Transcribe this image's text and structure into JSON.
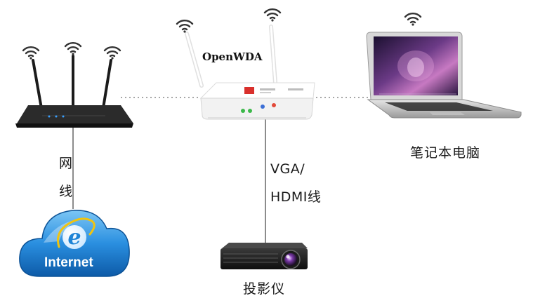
{
  "diagram": {
    "nodes": {
      "router": {
        "label": ""
      },
      "openwda": {
        "label": "OpenWDA"
      },
      "laptop": {
        "label": "笔记本电脑"
      },
      "internet": {
        "label": "Internet"
      },
      "projector": {
        "label": "投影仪"
      }
    },
    "edges": {
      "router_internet": {
        "label_line1": "网",
        "label_line2": "线"
      },
      "openwda_projector": {
        "label_line1": "VGA/",
        "label_line2": "HDMI线"
      }
    },
    "colors": {
      "dotted_link": "#a6a6a6",
      "cable": "#8c8c8c",
      "cloud_blue": "#1a7fd4",
      "router_body": "#222222",
      "openwda_body": "#f4f4f4",
      "accent_red": "#d9302c"
    }
  }
}
